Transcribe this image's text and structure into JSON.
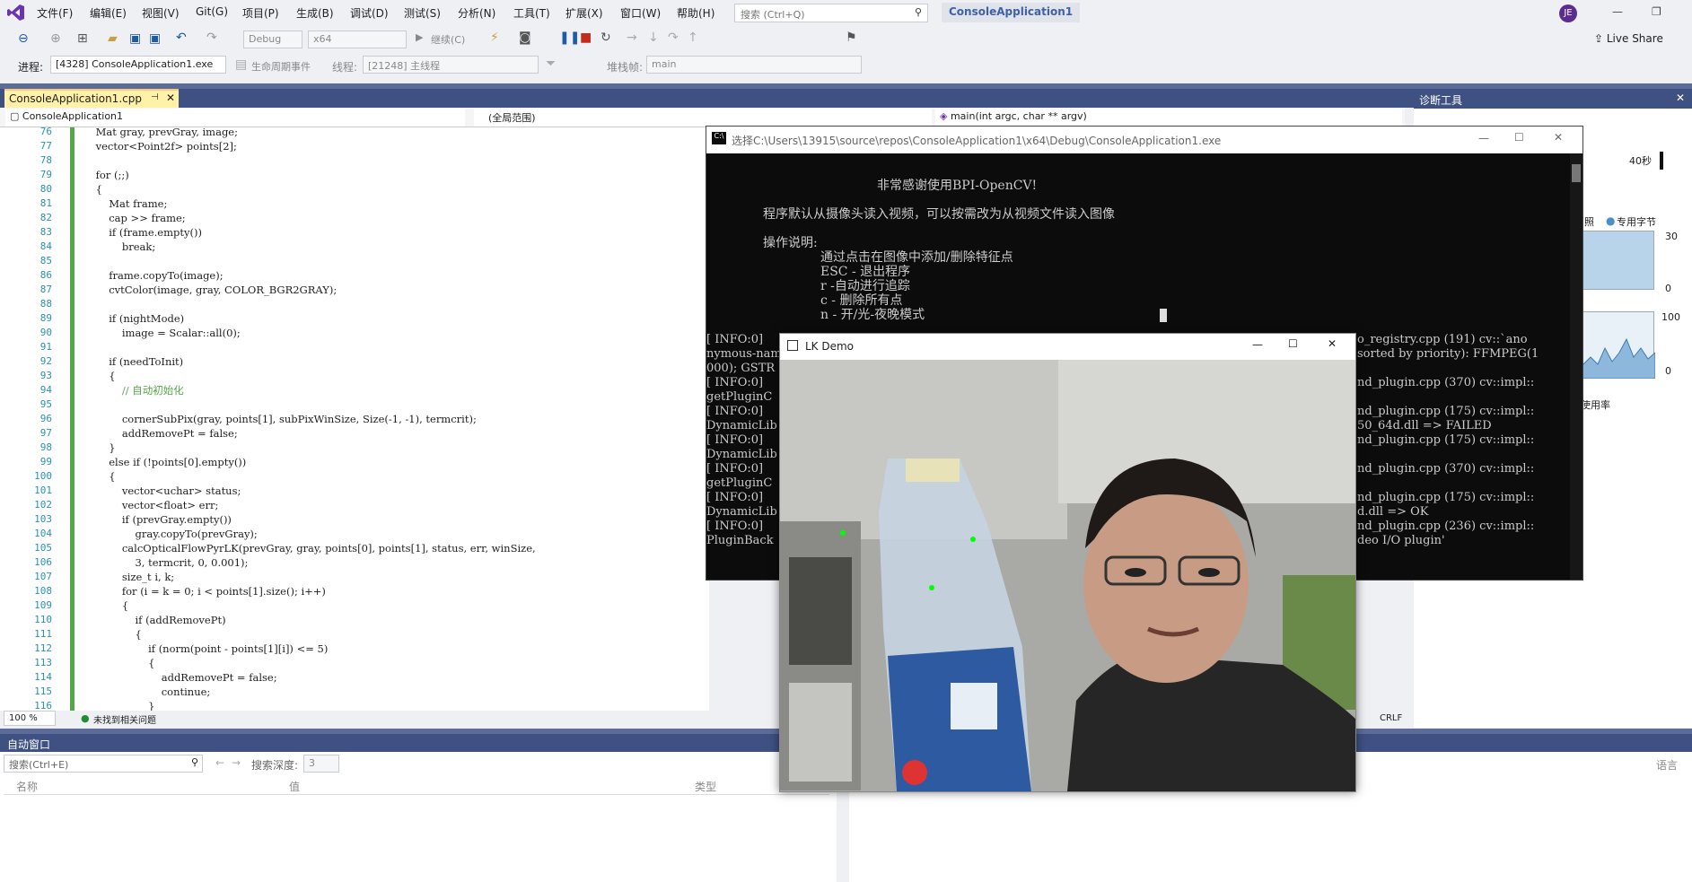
{
  "menu": {
    "items": [
      "文件(F)",
      "编辑(E)",
      "视图(V)",
      "Git(G)",
      "项目(P)",
      "生成(B)",
      "调试(D)",
      "测试(S)",
      "分析(N)",
      "工具(T)",
      "扩展(X)",
      "窗口(W)",
      "帮助(H)"
    ],
    "search_placeholder": "搜索 (Ctrl+Q)",
    "solution_title": "ConsoleApplication1",
    "user_initials": "JE",
    "live_share": "Live Share"
  },
  "toolbar": {
    "config": "Debug",
    "platform": "x64",
    "continue": "继续(C)"
  },
  "debugbar": {
    "process_label": "进程:",
    "process_value": "[4328] ConsoleApplication1.exe",
    "lifecycle": "生命周期事件",
    "thread_label": "线程:",
    "thread_value": "[21248] 主线程",
    "stack_label": "堆栈帧:",
    "stack_value": "main"
  },
  "editor": {
    "tab_title": "ConsoleApplication1.cpp",
    "nav_project": "ConsoleApplication1",
    "nav_scope": "(全局范围)",
    "nav_member": "main(int argc, char ** argv)",
    "zoom": "100 %",
    "issues": "未找到相关问题",
    "line_ending": "CRLF",
    "lines": [
      {
        "n": "76",
        "t": "    Mat gray, prevGray, image;"
      },
      {
        "n": "77",
        "t": "    vector<Point2f> points[2];"
      },
      {
        "n": "78",
        "t": ""
      },
      {
        "n": "79",
        "t": "    for (;;)"
      },
      {
        "n": "80",
        "t": "    {"
      },
      {
        "n": "81",
        "t": "        Mat frame;"
      },
      {
        "n": "82",
        "t": "        cap >> frame;"
      },
      {
        "n": "83",
        "t": "        if (frame.empty())"
      },
      {
        "n": "84",
        "t": "            break;"
      },
      {
        "n": "85",
        "t": ""
      },
      {
        "n": "86",
        "t": "        frame.copyTo(image);"
      },
      {
        "n": "87",
        "t": "        cvtColor(image, gray, COLOR_BGR2GRAY);"
      },
      {
        "n": "88",
        "t": ""
      },
      {
        "n": "89",
        "t": "        if (nightMode)"
      },
      {
        "n": "90",
        "t": "            image = Scalar::all(0);"
      },
      {
        "n": "91",
        "t": ""
      },
      {
        "n": "92",
        "t": "        if (needToInit)"
      },
      {
        "n": "93",
        "t": "        {"
      },
      {
        "n": "94",
        "t": "            // 自动初始化"
      },
      {
        "n": "95",
        "t": ""
      },
      {
        "n": "96",
        "t": "            cornerSubPix(gray, points[1], subPixWinSize, Size(-1, -1), termcrit);"
      },
      {
        "n": "97",
        "t": "            addRemovePt = false;"
      },
      {
        "n": "98",
        "t": "        }"
      },
      {
        "n": "99",
        "t": "        else if (!points[0].empty())"
      },
      {
        "n": "100",
        "t": "        {"
      },
      {
        "n": "101",
        "t": "            vector<uchar> status;"
      },
      {
        "n": "102",
        "t": "            vector<float> err;"
      },
      {
        "n": "103",
        "t": "            if (prevGray.empty())"
      },
      {
        "n": "104",
        "t": "                gray.copyTo(prevGray);"
      },
      {
        "n": "105",
        "t": "            calcOpticalFlowPyrLK(prevGray, gray, points[0], points[1], status, err, winSize,"
      },
      {
        "n": "106",
        "t": "                3, termcrit, 0, 0.001);"
      },
      {
        "n": "107",
        "t": "            size_t i, k;"
      },
      {
        "n": "108",
        "t": "            for (i = k = 0; i < points[1].size(); i++)"
      },
      {
        "n": "109",
        "t": "            {"
      },
      {
        "n": "110",
        "t": "                if (addRemovePt)"
      },
      {
        "n": "111",
        "t": "                {"
      },
      {
        "n": "112",
        "t": "                    if (norm(point - points[1][i]) <= 5)"
      },
      {
        "n": "113",
        "t": "                    {"
      },
      {
        "n": "114",
        "t": "                        addRemovePt = false;"
      },
      {
        "n": "115",
        "t": "                        continue;"
      },
      {
        "n": "116",
        "t": "                    }"
      }
    ]
  },
  "autos": {
    "title": "自动窗口",
    "search_placeholder": "搜索(Ctrl+E)",
    "depth_label": "搜索深度:",
    "depth_value": "3",
    "col_name": "名称",
    "col_value": "值",
    "col_type": "类型",
    "lang": "语言"
  },
  "diagnostics": {
    "title": "诊断工具",
    "time": "40秒",
    "legend_snapshot": "照",
    "legend_private": "专用字节",
    "y1_top": "30",
    "y1_bottom": "0",
    "y2_top": "100",
    "y2_bottom": "0",
    "usage": "使用率"
  },
  "console": {
    "title": "选择C:\\Users\\13915\\source\\repos\\ConsoleApplication1\\x64\\Debug\\ConsoleApplication1.exe",
    "line1": "非常感谢使用BPI-OpenCV!",
    "line2": "程序默认从摄像头读入视频，可以按需改为从视频文件读入图像",
    "line3": "操作说明:",
    "line4": "通过点击在图像中添加/删除特征点",
    "line5": "ESC - 退出程序",
    "line6": "r -自动进行追踪",
    "line7": "c - 删除所有点",
    "line8": "n - 开/光-夜晚模式",
    "left_log": [
      "[ INFO:0]",
      "nymous-nam",
      "000); GSTR",
      "[ INFO:0]",
      "getPluginC",
      "[ INFO:0]",
      "DynamicLib",
      "[ INFO:0]",
      "DynamicLib",
      "[ INFO:0]",
      "getPluginC",
      "[ INFO:0]",
      "DynamicLib",
      "[ INFO:0]",
      "PluginBack"
    ],
    "right_log": [
      "o_registry.cpp (191) cv::`ano",
      "sorted by priority): FFMPEG(1",
      "",
      "nd_plugin.cpp (370) cv::impl::",
      "",
      "nd_plugin.cpp (175) cv::impl::",
      "50_64d.dll => FAILED",
      "nd_plugin.cpp (175) cv::impl::",
      "",
      "nd_plugin.cpp (370) cv::impl::",
      "",
      "nd_plugin.cpp (175) cv::impl::",
      "d.dll => OK",
      "nd_plugin.cpp (236) cv::impl::",
      "deo I/O plugin'"
    ]
  },
  "lkdemo": {
    "title": "LK Demo"
  }
}
